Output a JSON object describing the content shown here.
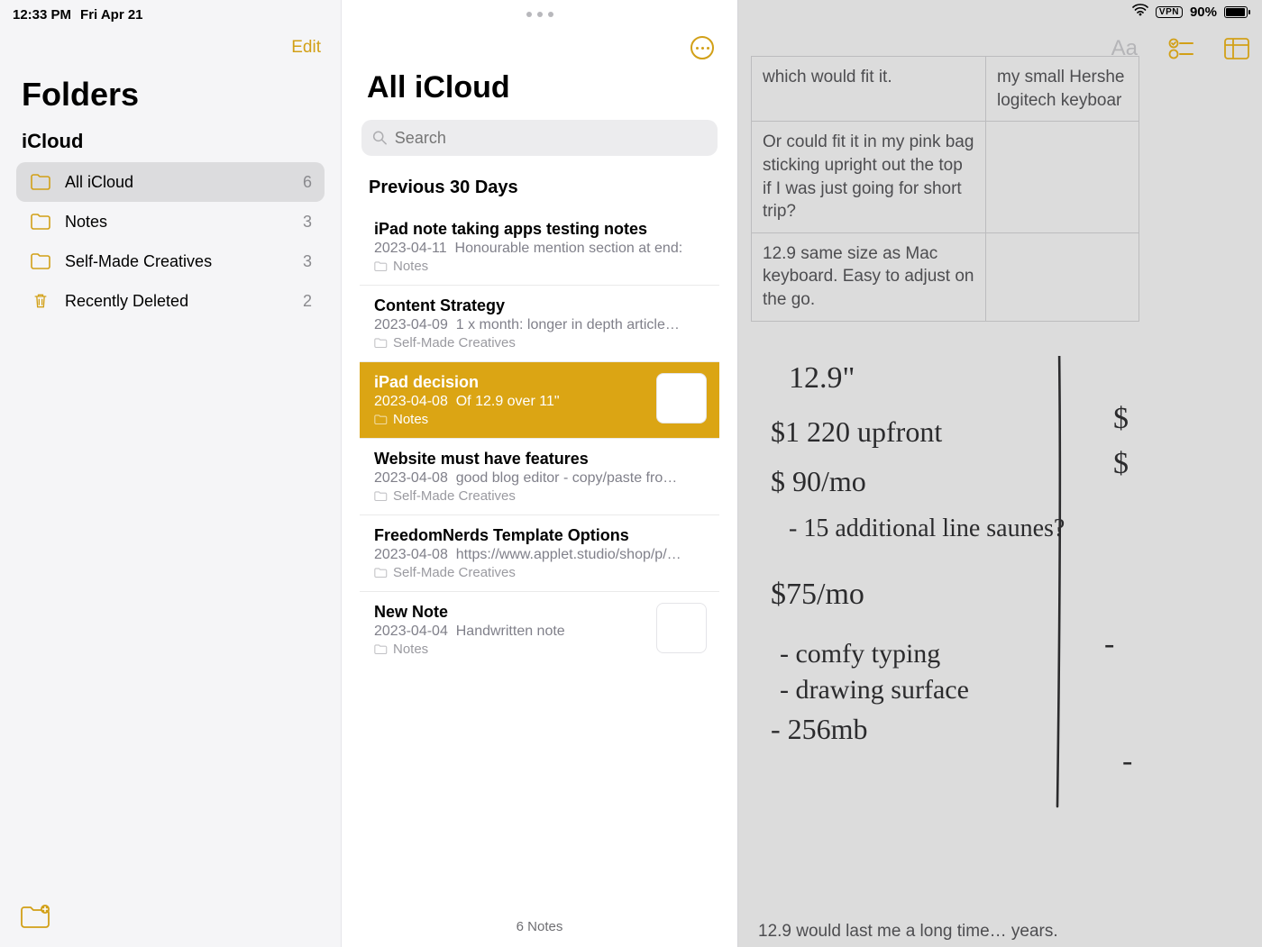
{
  "statusbar": {
    "time": "12:33 PM",
    "date": "Fri Apr 21",
    "vpn": "VPN",
    "battery_pct": "90%"
  },
  "folders_pane": {
    "edit_label": "Edit",
    "title": "Folders",
    "account": "iCloud",
    "items": [
      {
        "name": "All iCloud",
        "count": "6",
        "selected": true,
        "icon": "folder"
      },
      {
        "name": "Notes",
        "count": "3",
        "selected": false,
        "icon": "folder"
      },
      {
        "name": "Self-Made Creatives",
        "count": "3",
        "selected": false,
        "icon": "folder"
      },
      {
        "name": "Recently Deleted",
        "count": "2",
        "selected": false,
        "icon": "trash"
      }
    ]
  },
  "notes_pane": {
    "title": "All iCloud",
    "search_placeholder": "Search",
    "section_header": "Previous 30 Days",
    "notes": [
      {
        "title": "iPad note taking apps testing notes",
        "date": "2023-04-11",
        "preview": "Honourable mention section at end:",
        "folder": "Notes",
        "selected": false,
        "thumb": false
      },
      {
        "title": "Content Strategy",
        "date": "2023-04-09",
        "preview": "1 x month: longer in depth article…",
        "folder": "Self-Made Creatives",
        "selected": false,
        "thumb": false
      },
      {
        "title": "iPad decision",
        "date": "2023-04-08",
        "preview": "Of 12.9 over 11\"",
        "folder": "Notes",
        "selected": true,
        "thumb": true
      },
      {
        "title": "Website must have features",
        "date": "2023-04-08",
        "preview": "good blog editor - copy/paste fro…",
        "folder": "Self-Made Creatives",
        "selected": false,
        "thumb": false
      },
      {
        "title": "FreedomNerds Template Options",
        "date": "2023-04-08",
        "preview": "https://www.applet.studio/shop/p/…",
        "folder": "Self-Made Creatives",
        "selected": false,
        "thumb": false
      },
      {
        "title": "New Note",
        "date": "2023-04-04",
        "preview": "Handwritten note",
        "folder": "Notes",
        "selected": false,
        "thumb": true,
        "thumb_blank": true
      }
    ],
    "footer": "6 Notes"
  },
  "editor": {
    "table_rows": [
      {
        "c1": "which would fit it.",
        "c2": "my small Hershe logitech keyboar"
      },
      {
        "c1": "Or could fit it in my pink bag sticking upright out the top if I was just going for short trip?",
        "c2": ""
      },
      {
        "c1": "12.9 same size as Mac keyboard. Easy to adjust on the go.",
        "c2": ""
      }
    ],
    "handwriting_lines": [
      "12.9\"",
      "$1 220 upfront",
      "$ 90/mo",
      "- 15 additional line saunes?",
      "$75/mo",
      "- comfy typing",
      "- drawing surface",
      "- 256mb"
    ],
    "handwriting_right": [
      "$",
      "$",
      "-",
      "-"
    ],
    "footer_text": "12.9 would last me a long time… years."
  }
}
